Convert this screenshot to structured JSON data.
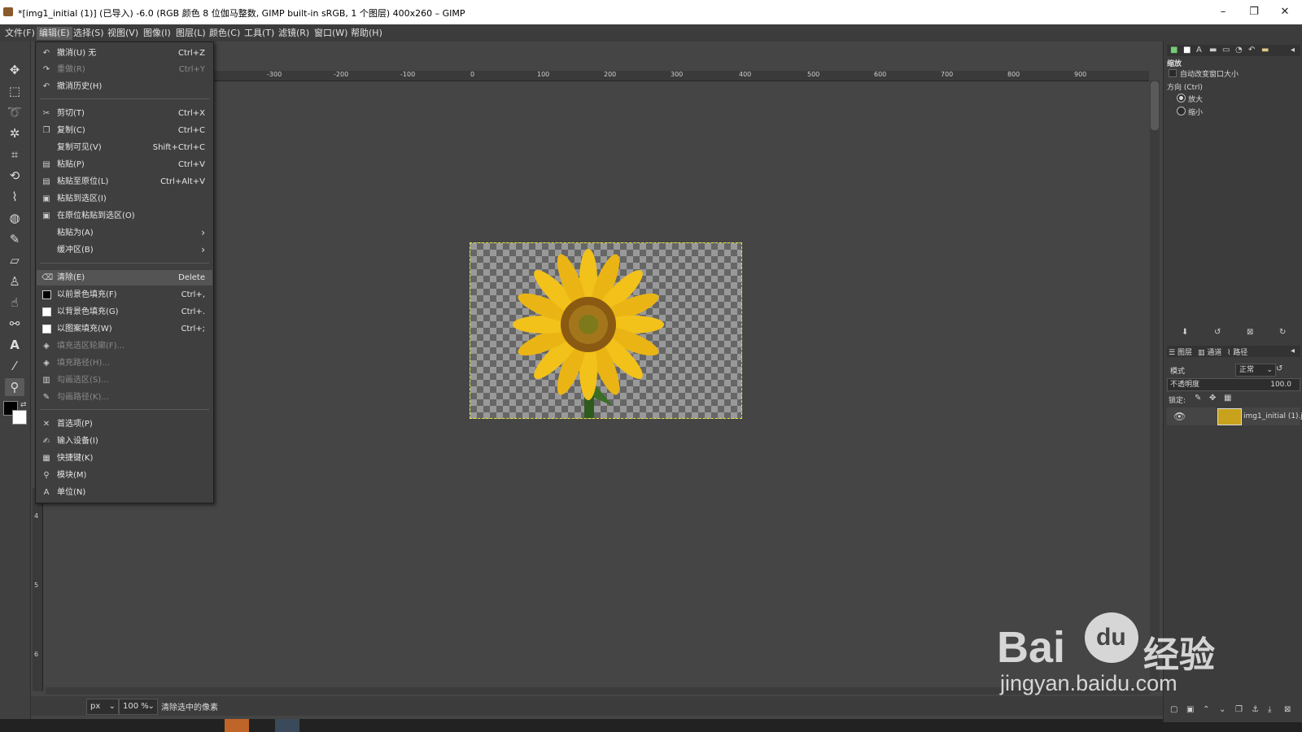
{
  "window": {
    "title": "*[img1_initial (1)] (已导入) -6.0 (RGB 颜色 8 位伽马整数, GIMP built-in sRGB, 1 个图层) 400x260 – GIMP",
    "minimize": "–",
    "maximize": "❐",
    "close": "✕"
  },
  "menubar": [
    "文件(F)",
    "编辑(E)",
    "选择(S)",
    "视图(V)",
    "图像(I)",
    "图层(L)",
    "颜色(C)",
    "工具(T)",
    "滤镜(R)",
    "窗口(W)",
    "帮助(H)"
  ],
  "edit_menu": {
    "items": [
      {
        "icon": "undo-icon",
        "glyph": "↶",
        "label": "撤消(U) 无",
        "shortcut": "Ctrl+Z"
      },
      {
        "icon": "redo-icon",
        "glyph": "↷",
        "label": "重做(R)",
        "shortcut": "Ctrl+Y"
      },
      {
        "icon": "undo-history-icon",
        "glyph": "↶",
        "label": "撤消历史(H)",
        "shortcut": ""
      },
      {
        "icon": "cut-icon",
        "glyph": "✂",
        "label": "剪切(T)",
        "shortcut": "Ctrl+X"
      },
      {
        "icon": "copy-icon",
        "glyph": "❐",
        "label": "复制(C)",
        "shortcut": "Ctrl+C"
      },
      {
        "icon": "",
        "glyph": "",
        "label": "复制可见(V)",
        "shortcut": "Shift+Ctrl+C"
      },
      {
        "icon": "paste-icon",
        "glyph": "▤",
        "label": "粘贴(P)",
        "shortcut": "Ctrl+V"
      },
      {
        "icon": "paste-in-place-icon",
        "glyph": "▤",
        "label": "粘贴至原位(L)",
        "shortcut": "Ctrl+Alt+V"
      },
      {
        "icon": "paste-into-icon",
        "glyph": "▣",
        "label": "粘贴到选区(I)",
        "shortcut": ""
      },
      {
        "icon": "paste-into-in-place-icon",
        "glyph": "▣",
        "label": "在原位粘贴到选区(O)",
        "shortcut": ""
      },
      {
        "icon": "",
        "glyph": "",
        "label": "粘贴为(A)",
        "shortcut": ""
      },
      {
        "icon": "",
        "glyph": "",
        "label": "缓冲区(B)",
        "shortcut": ""
      },
      {
        "icon": "clear-icon",
        "glyph": "⌫",
        "label": "清除(E)",
        "shortcut": "Delete"
      },
      {
        "icon": "fg-fill-icon",
        "glyph": "",
        "label": "以前景色填充(F)",
        "shortcut": "Ctrl+,"
      },
      {
        "icon": "bg-fill-icon",
        "glyph": "",
        "label": "以背景色填充(G)",
        "shortcut": "Ctrl+."
      },
      {
        "icon": "pattern-fill-icon",
        "glyph": "",
        "label": "以图案填充(W)",
        "shortcut": "Ctrl+;"
      },
      {
        "icon": "fill-selection-outline-icon",
        "glyph": "◈",
        "label": "填充选区轮廓(F)...",
        "shortcut": ""
      },
      {
        "icon": "fill-path-icon",
        "glyph": "◈",
        "label": "填充路径(H)...",
        "shortcut": ""
      },
      {
        "icon": "stroke-selection-icon",
        "glyph": "▥",
        "label": "勾画选区(S)...",
        "shortcut": ""
      },
      {
        "icon": "stroke-path-icon",
        "glyph": "✎",
        "label": "勾画路径(K)...",
        "shortcut": ""
      },
      {
        "icon": "preferences-icon",
        "glyph": "✕",
        "label": "首选项(P)",
        "shortcut": ""
      },
      {
        "icon": "input-devices-icon",
        "glyph": "✍",
        "label": "输入设备(I)",
        "shortcut": ""
      },
      {
        "icon": "keyboard-shortcuts-icon",
        "glyph": "▦",
        "label": "快捷键(K)",
        "shortcut": ""
      },
      {
        "icon": "modules-icon",
        "glyph": "⚲",
        "label": "模块(M)",
        "shortcut": ""
      },
      {
        "icon": "units-icon",
        "glyph": "A",
        "label": "单位(N)",
        "shortcut": ""
      }
    ]
  },
  "ruler": {
    "h_ticks": [
      "-300",
      "-200",
      "-100",
      "0",
      "100",
      "200",
      "300",
      "400",
      "500",
      "600",
      "700",
      "800",
      "900"
    ],
    "v_ticks": [
      "4",
      "5",
      "6"
    ]
  },
  "status": {
    "unit": "px",
    "zoom": "100 %",
    "message": "清除选中的像素"
  },
  "zoom_options": {
    "title": "缩放",
    "auto_resize": "自动改变窗口大小",
    "direction_label": "方向 (Ctrl)",
    "zoom_in": "放大",
    "zoom_out": "缩小",
    "selected": "放大"
  },
  "layers_panel": {
    "tabs": [
      "图层",
      "通道",
      "路径"
    ],
    "mode_label": "模式",
    "mode_value": "正常",
    "opacity_label": "不透明度",
    "opacity_value": "100.0",
    "lock_label": "锁定:",
    "layer_name": "img1_initial (1).j"
  },
  "watermark": {
    "brand": "Bai",
    "brand_tail": "经验",
    "paw_text": "du",
    "url": "jingyan.baidu.com"
  },
  "colors": {
    "accent_selection": "#e8e830",
    "sunflower": "#f2c21a"
  }
}
